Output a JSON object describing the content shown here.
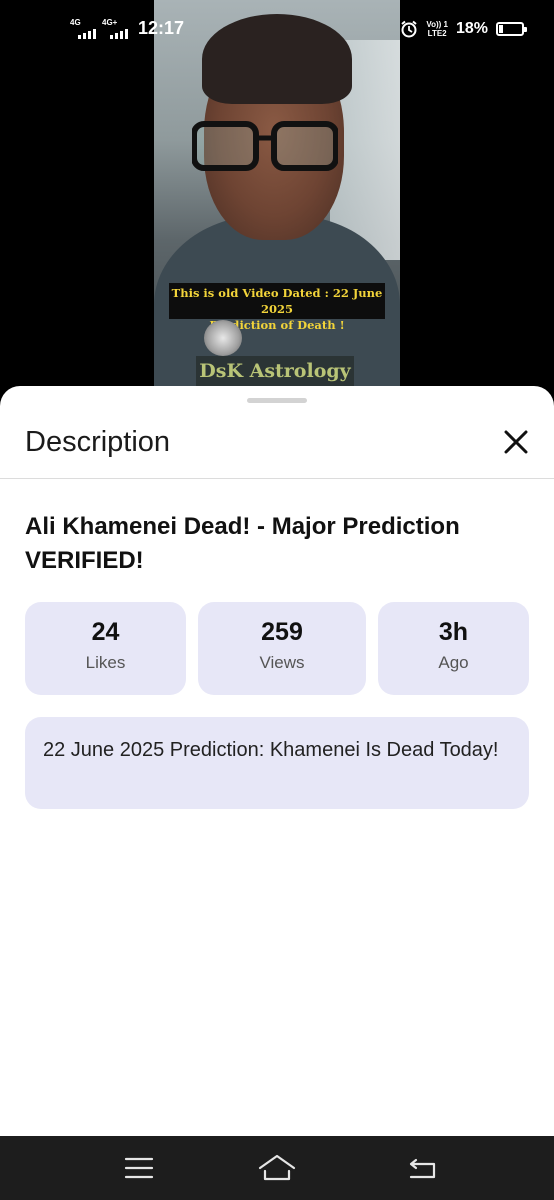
{
  "status_bar": {
    "network_1": "4G",
    "network_2": "4G+",
    "time": "12:17",
    "volte_line1": "Vo)) 1",
    "volte_line2": "LTE2",
    "battery_percent": "18%",
    "battery_level": 0.18,
    "icons": [
      "signal-icon",
      "alarm-icon",
      "battery-icon"
    ]
  },
  "video": {
    "overlay_line1": "This is old Video Dated : 22 June 2025",
    "overlay_line2": "Prediction of Death !",
    "brand": "DsK Astrology"
  },
  "sheet": {
    "title": "Description",
    "close_icon": "close-icon"
  },
  "video_title": "Ali Khamenei Dead! - Major Prediction VERIFIED!",
  "stats": [
    {
      "value": "24",
      "label": "Likes"
    },
    {
      "value": "259",
      "label": "Views"
    },
    {
      "value": "3h",
      "label": "Ago"
    }
  ],
  "description_text": "22 June 2025 Prediction: Khamenei Is Dead Today!",
  "nav_bar": {
    "icons": [
      "menu-icon",
      "home-icon",
      "back-icon"
    ]
  },
  "colors": {
    "card_background": "#e7e7f7",
    "overlay_text": "#f2d43a",
    "nav_background": "#1d1d1d"
  }
}
